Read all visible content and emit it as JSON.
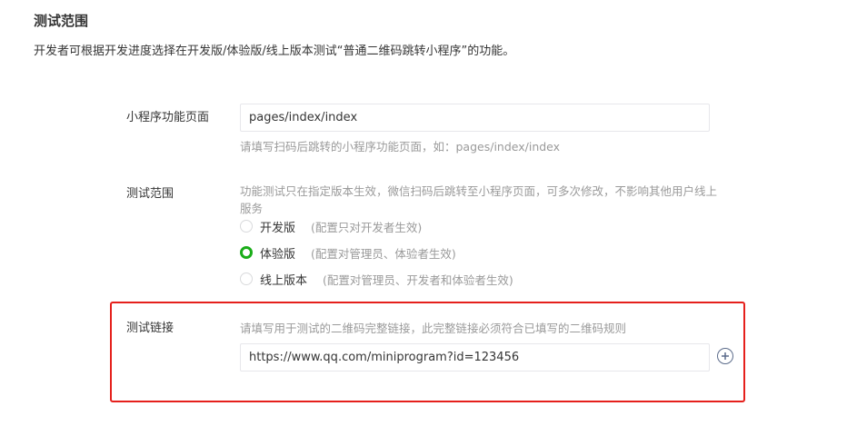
{
  "section": {
    "title": "测试范围",
    "description": "开发者可根据开发进度选择在开发版/体验版/线上版本测试“普通二维码跳转小程序”的功能。"
  },
  "page_field": {
    "label": "小程序功能页面",
    "value": "pages/index/index",
    "hint": "请填写扫码后跳转的小程序功能页面，如：pages/index/index"
  },
  "scope_field": {
    "label": "测试范围",
    "description": "功能测试只在指定版本生效，微信扫码后跳转至小程序页面，可多次修改，不影响其他用户线上服务",
    "options": [
      {
        "label": "开发版",
        "note": "(配置只对开发者生效)",
        "checked": false
      },
      {
        "label": "体验版",
        "note": "(配置对管理员、体验者生效)",
        "checked": true
      },
      {
        "label": "线上版本",
        "note": "(配置对管理员、开发者和体验者生效)",
        "checked": false
      }
    ]
  },
  "link_field": {
    "label": "测试链接",
    "hint": "请填写用于测试的二维码完整链接，此完整链接必须符合已填写的二维码规则",
    "value": "https://www.qq.com/miniprogram?id=123456",
    "add_icon": "plus-circle-icon"
  },
  "colors": {
    "accent_green": "#1aad19",
    "highlight_red": "#e5201c",
    "hint_gray": "#9a9a9a"
  }
}
